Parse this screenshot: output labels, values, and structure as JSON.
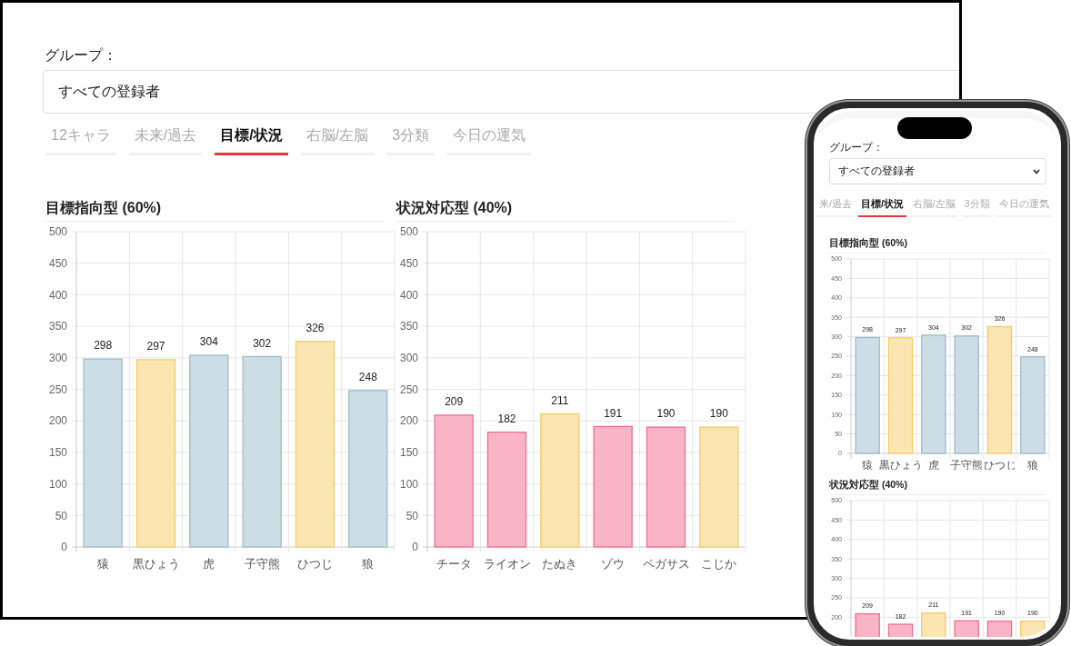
{
  "desktop": {
    "group_label": "グループ：",
    "group_select": {
      "value": "すべての登録者"
    },
    "tabs": [
      {
        "label": "12キャラ",
        "selected": false
      },
      {
        "label": "未来/過去",
        "selected": false
      },
      {
        "label": "目標/状況",
        "selected": true
      },
      {
        "label": "右脳/左脳",
        "selected": false
      },
      {
        "label": "3分類",
        "selected": false
      },
      {
        "label": "今日の運気",
        "selected": false
      }
    ],
    "charts": [
      {
        "title": "目標指向型 (60%)",
        "chart_data": {
          "type": "bar",
          "categories": [
            "猿",
            "黒ひょう",
            "虎",
            "子守熊",
            "ひつじ",
            "狼"
          ],
          "series": [
            {
              "values": [
                298,
                297,
                304,
                302,
                326,
                248
              ],
              "colors": [
                "#cddde5",
                "#fbe5b0",
                "#cddde5",
                "#cddde5",
                "#fbe5b0",
                "#cddde5"
              ]
            }
          ],
          "ylim": [
            0,
            500
          ],
          "yticks": [
            0,
            50,
            100,
            150,
            200,
            250,
            300,
            350,
            400,
            450,
            500
          ],
          "data_labels": true,
          "grid": true
        }
      },
      {
        "title": "状況対応型 (40%)",
        "chart_data": {
          "type": "bar",
          "categories": [
            "チータ",
            "ライオン",
            "たぬき",
            "ゾウ",
            "ペガサス",
            "こじか"
          ],
          "series": [
            {
              "values": [
                209,
                182,
                211,
                191,
                190,
                190
              ],
              "colors": [
                "#f9b4c5",
                "#f9b4c5",
                "#fbe5b0",
                "#f9b4c5",
                "#f9b4c5",
                "#fbe5b0"
              ]
            }
          ],
          "ylim": [
            0,
            500
          ],
          "yticks": [
            0,
            50,
            100,
            150,
            200,
            250,
            300,
            350,
            400,
            450,
            500
          ],
          "data_labels": true,
          "grid": true
        }
      }
    ]
  },
  "phone": {
    "group_label": "グループ：",
    "group_select": {
      "value": "すべての登録者"
    },
    "tabs": [
      {
        "label": "来/過去",
        "selected": false
      },
      {
        "label": "目標/状況",
        "selected": true
      },
      {
        "label": "右脳/左脳",
        "selected": false
      },
      {
        "label": "3分類",
        "selected": false
      },
      {
        "label": "今日の運気",
        "selected": false
      }
    ],
    "charts": [
      {
        "title": "目標指向型 (60%)",
        "chart_data": {
          "type": "bar",
          "categories": [
            "猿",
            "黒ひょう",
            "虎",
            "子守熊",
            "ひつじ",
            "狼"
          ],
          "series": [
            {
              "values": [
                298,
                297,
                304,
                302,
                326,
                248
              ],
              "colors": [
                "#cddde5",
                "#fbe5b0",
                "#cddde5",
                "#cddde5",
                "#fbe5b0",
                "#cddde5"
              ]
            }
          ],
          "ylim": [
            0,
            500
          ],
          "yticks": [
            0,
            50,
            100,
            150,
            200,
            250,
            300,
            350,
            400,
            450,
            500
          ],
          "data_labels": true,
          "grid": true
        }
      },
      {
        "title": "状況対応型 (40%)",
        "chart_data": {
          "type": "bar",
          "series": [
            {
              "values": [
                209,
                182,
                211,
                191,
                190,
                190
              ],
              "colors": [
                "#f9b4c5",
                "#f9b4c5",
                "#fbe5b0",
                "#f9b4c5",
                "#f9b4c5",
                "#fbe5b0"
              ]
            }
          ],
          "ylim": [
            0,
            500
          ],
          "yticks": [
            200,
            250,
            300,
            350,
            400,
            450,
            500
          ],
          "data_labels": true,
          "grid": true
        }
      }
    ]
  }
}
